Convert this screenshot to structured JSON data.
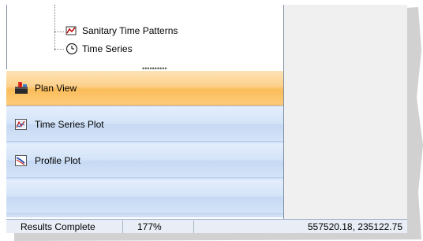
{
  "tree": {
    "items": [
      {
        "label": "Sanitary Time Patterns",
        "icon": "pattern-icon"
      },
      {
        "label": "Time Series",
        "icon": "clock-icon"
      }
    ],
    "grip": "••••••••••"
  },
  "nav": {
    "items": [
      {
        "label": "Plan View",
        "icon": "plan-view-icon",
        "active": true
      },
      {
        "label": "Time Series Plot",
        "icon": "time-series-plot-icon",
        "active": false
      },
      {
        "label": "Profile Plot",
        "icon": "profile-plot-icon",
        "active": false
      }
    ]
  },
  "status": {
    "message": "Results Complete",
    "zoom": "177%",
    "coordinates": "557520.18, 235122.75"
  },
  "colors": {
    "active_nav": "#fbbd5b",
    "nav_background": "#d3e3f8",
    "status_background": "#e9eef6"
  }
}
